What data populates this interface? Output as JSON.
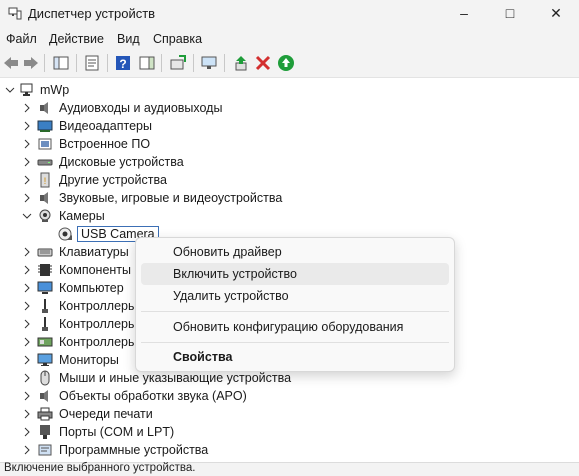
{
  "window": {
    "title": "Диспетчер устройств"
  },
  "menubar": {
    "items": [
      "Файл",
      "Действие",
      "Вид",
      "Справка"
    ]
  },
  "tree": {
    "root": "mWp",
    "categories": [
      {
        "label": "Аудиовходы и аудиовыходы",
        "icon": "speaker-icon",
        "expanded": false
      },
      {
        "label": "Видеоадаптеры",
        "icon": "display-adapter-icon",
        "expanded": false
      },
      {
        "label": "Встроенное ПО",
        "icon": "firmware-icon",
        "expanded": false
      },
      {
        "label": "Дисковые устройства",
        "icon": "disk-drive-icon",
        "expanded": false
      },
      {
        "label": "Другие устройства",
        "icon": "other-devices-icon",
        "expanded": false
      },
      {
        "label": "Звуковые, игровые и видеоустройства",
        "icon": "speaker-icon",
        "expanded": false
      },
      {
        "label": "Камеры",
        "icon": "camera-icon",
        "expanded": true
      },
      {
        "label": "USB Camera",
        "icon": "disabled-camera-icon",
        "child": true
      },
      {
        "label": "Клавиатуры",
        "icon": "keyboard-icon",
        "expanded": false
      },
      {
        "label": "Компоненты",
        "icon": "components-icon",
        "expanded": false
      },
      {
        "label": "Компьютер",
        "icon": "computer-icon",
        "expanded": false
      },
      {
        "label": "Контроллеры",
        "icon": "usb-controller-icon",
        "expanded": false
      },
      {
        "label": "Контроллеры",
        "icon": "usb-controller-icon",
        "expanded": false
      },
      {
        "label": "Контроллеры",
        "icon": "storage-controller-icon",
        "expanded": false
      },
      {
        "label": "Мониторы",
        "icon": "monitor-icon",
        "expanded": false
      },
      {
        "label": "Мыши и иные указывающие устройства",
        "icon": "mouse-icon",
        "expanded": false
      },
      {
        "label": "Объекты обработки звука (APO)",
        "icon": "speaker-icon",
        "expanded": false
      },
      {
        "label": "Очереди печати",
        "icon": "printer-icon",
        "expanded": false
      },
      {
        "label": "Порты (COM и LPT)",
        "icon": "port-icon",
        "expanded": false
      },
      {
        "label": "Программные устройства",
        "icon": "software-device-icon",
        "expanded": false
      }
    ]
  },
  "context_menu": {
    "items": [
      {
        "label": "Обновить драйвер"
      },
      {
        "label": "Включить устройство",
        "highlighted": true
      },
      {
        "label": "Удалить устройство"
      },
      {
        "label": "Обновить конфигурацию оборудования"
      },
      {
        "label": "Свойства",
        "bold": true
      }
    ]
  },
  "statusbar": {
    "text": "Включение выбранного устройства."
  },
  "colors": {
    "accent_green": "#1f9d3a",
    "delete_red": "#d32f2f",
    "help_blue": "#2456b8"
  }
}
